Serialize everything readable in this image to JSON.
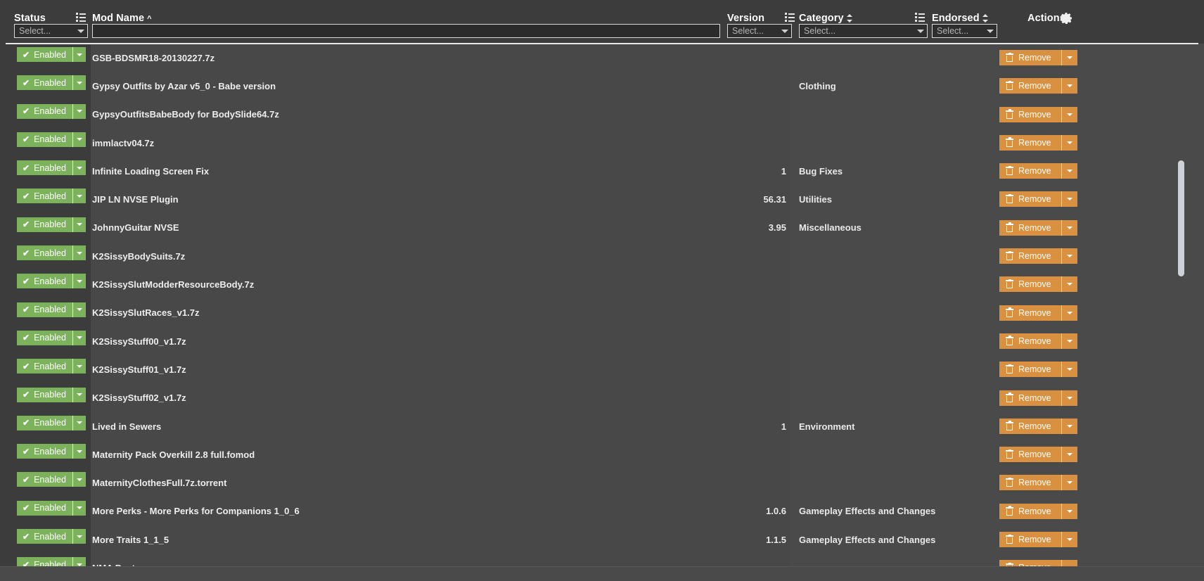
{
  "columns": {
    "status": {
      "title": "Status",
      "filter_placeholder": "Select...",
      "menu_icon": "list-menu-icon"
    },
    "modname": {
      "title": "Mod Name",
      "sort": "^",
      "filter_value": "",
      "filter_placeholder": "",
      "menu_icon": "list-menu-icon"
    },
    "version": {
      "title": "Version",
      "filter_placeholder": "Select...",
      "menu_icon": "list-menu-icon"
    },
    "category": {
      "title": "Category",
      "sort": "sort-updown-icon",
      "filter_placeholder": "Select...",
      "menu_icon": "list-menu-icon"
    },
    "endorsed": {
      "title": "Endorsed",
      "sort": "sort-updown-icon",
      "filter_placeholder": "Select...",
      "menu_icon": "list-menu-icon"
    },
    "actions": {
      "title": "Actions",
      "settings_icon": "gear-icon"
    }
  },
  "labels": {
    "status_enabled": "Enabled",
    "remove": "Remove",
    "check_glyph": "✔",
    "endorse_glyph": "thumbs-up-icon"
  },
  "colors": {
    "enabled_green": "#7cb25c",
    "remove_orange": "#d99141",
    "header_bg": "#3c3c3c",
    "body_bg": "#4a4a4a",
    "modname_band": "#484848",
    "text": "#ededed"
  },
  "rows": [
    {
      "status": "Enabled",
      "name": "GSB-BDSMR18-20130227.7z",
      "version": "",
      "category": "",
      "endorsed": false,
      "action": "Remove"
    },
    {
      "status": "Enabled",
      "name": "Gypsy Outfits by Azar v5_0 - Babe version",
      "version": "",
      "category": "Clothing",
      "endorsed": true,
      "action": "Remove"
    },
    {
      "status": "Enabled",
      "name": "GypsyOutfitsBabeBody for BodySlide64.7z",
      "version": "",
      "category": "",
      "endorsed": false,
      "action": "Remove"
    },
    {
      "status": "Enabled",
      "name": "immlactv04.7z",
      "version": "",
      "category": "",
      "endorsed": false,
      "action": "Remove"
    },
    {
      "status": "Enabled",
      "name": "Infinite Loading Screen Fix",
      "version": "1",
      "category": "Bug Fixes",
      "endorsed": true,
      "action": "Remove"
    },
    {
      "status": "Enabled",
      "name": "JIP LN NVSE Plugin",
      "version": "56.31",
      "category": "Utilities",
      "endorsed": true,
      "action": "Remove"
    },
    {
      "status": "Enabled",
      "name": "JohnnyGuitar NVSE",
      "version": "3.95",
      "category": "Miscellaneous",
      "endorsed": true,
      "action": "Remove"
    },
    {
      "status": "Enabled",
      "name": "K2SissyBodySuits.7z",
      "version": "",
      "category": "",
      "endorsed": false,
      "action": "Remove"
    },
    {
      "status": "Enabled",
      "name": "K2SissySlutModderResourceBody.7z",
      "version": "",
      "category": "",
      "endorsed": false,
      "action": "Remove"
    },
    {
      "status": "Enabled",
      "name": "K2SissySlutRaces_v1.7z",
      "version": "",
      "category": "",
      "endorsed": false,
      "action": "Remove"
    },
    {
      "status": "Enabled",
      "name": "K2SissyStuff00_v1.7z",
      "version": "",
      "category": "",
      "endorsed": false,
      "action": "Remove"
    },
    {
      "status": "Enabled",
      "name": "K2SissyStuff01_v1.7z",
      "version": "",
      "category": "",
      "endorsed": false,
      "action": "Remove"
    },
    {
      "status": "Enabled",
      "name": "K2SissyStuff02_v1.7z",
      "version": "",
      "category": "",
      "endorsed": false,
      "action": "Remove"
    },
    {
      "status": "Enabled",
      "name": "Lived in Sewers",
      "version": "1",
      "category": "Environment",
      "endorsed": true,
      "action": "Remove"
    },
    {
      "status": "Enabled",
      "name": "Maternity Pack Overkill 2.8 full.fomod",
      "version": "",
      "category": "",
      "endorsed": false,
      "action": "Remove"
    },
    {
      "status": "Enabled",
      "name": "MaternityClothesFull.7z.torrent",
      "version": "",
      "category": "",
      "endorsed": false,
      "action": "Remove"
    },
    {
      "status": "Enabled",
      "name": "More Perks - More Perks for Companions 1_0_6",
      "version": "1.0.6",
      "category": "Gameplay Effects and Changes",
      "endorsed": true,
      "action": "Remove"
    },
    {
      "status": "Enabled",
      "name": "More Traits 1_1_5",
      "version": "1.1.5",
      "category": "Gameplay Effects and Changes",
      "endorsed": true,
      "action": "Remove"
    },
    {
      "status": "Enabled",
      "name": "NMA Posters.rar",
      "version": "",
      "category": "",
      "endorsed": false,
      "action": "Remove"
    }
  ]
}
